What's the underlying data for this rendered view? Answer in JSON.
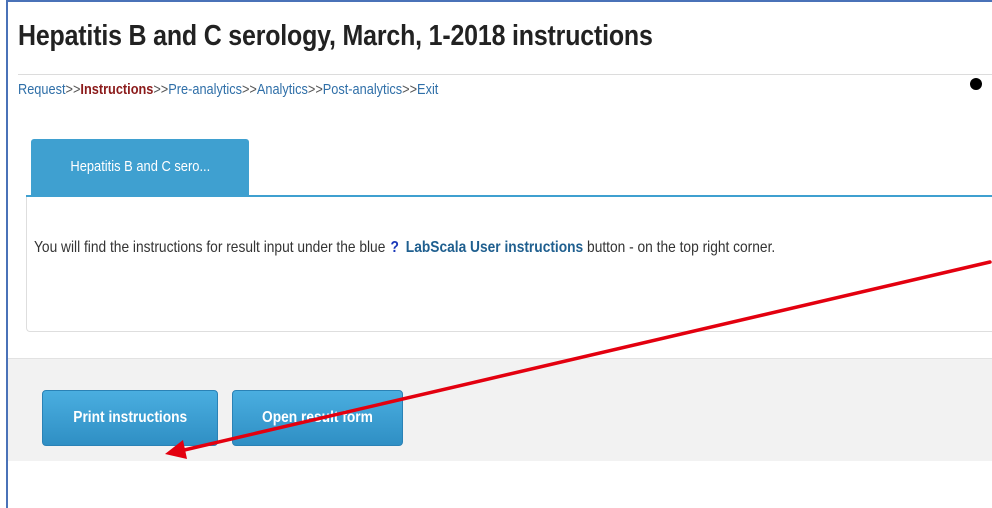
{
  "page": {
    "title": "Hepatitis B and C serology, March, 1-2018 instructions"
  },
  "breadcrumb": {
    "items": [
      "Request",
      "Instructions",
      "Pre-analytics",
      "Analytics",
      "Post-analytics",
      "Exit"
    ],
    "current": "Instructions",
    "separator": ">>"
  },
  "tabs": [
    {
      "label": "Hepatitis B and C sero..."
    }
  ],
  "panel": {
    "text_before": "You will find the instructions for result input under the blue",
    "question_mark": "?",
    "link_text": "LabScala User instructions",
    "text_after": "button - on the top right corner."
  },
  "buttons": {
    "print_label": "Print instructions",
    "open_label": "Open result form"
  },
  "annotation": {
    "arrow_color": "#e3000f"
  },
  "colors": {
    "accent": "#3fa0d0",
    "breadcrumb_link": "#2f6fa8",
    "breadcrumb_current": "#8b1a1a"
  }
}
